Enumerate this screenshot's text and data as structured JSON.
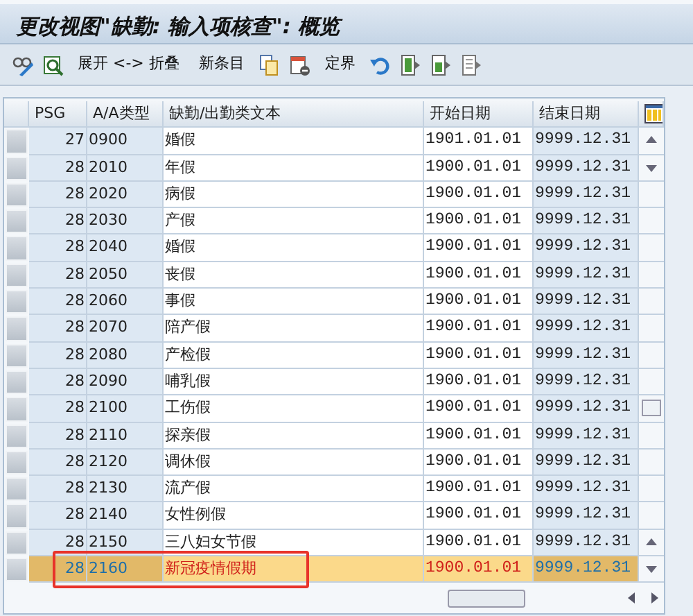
{
  "window": {
    "title": "更改视图\"缺勤: 输入项核查\": 概览"
  },
  "toolbar": [
    {
      "kind": "icon"
    },
    {
      "kind": "icon"
    },
    {
      "kind": "text",
      "label": "展开 <-> 折叠"
    },
    {
      "kind": "text",
      "label": "新条目"
    },
    {
      "kind": "icon"
    },
    {
      "kind": "icon"
    },
    {
      "kind": "text",
      "label": "定界"
    },
    {
      "kind": "icon"
    },
    {
      "kind": "icon"
    },
    {
      "kind": "icon"
    },
    {
      "kind": "icon"
    }
  ],
  "table": {
    "columns": [
      "PSG",
      "A/A类型",
      "缺勤/出勤类文本",
      "开始日期",
      "结束日期"
    ],
    "rows": [
      {
        "psg": "27",
        "type": "0900",
        "text": "婚假",
        "start": "1901.01.01",
        "end": "9999.12.31",
        "selected": false
      },
      {
        "psg": "28",
        "type": "2010",
        "text": "年假",
        "start": "1900.01.01",
        "end": "9999.12.31",
        "selected": false
      },
      {
        "psg": "28",
        "type": "2020",
        "text": "病假",
        "start": "1900.01.01",
        "end": "9999.12.31",
        "selected": false
      },
      {
        "psg": "28",
        "type": "2030",
        "text": "产假",
        "start": "1900.01.01",
        "end": "9999.12.31",
        "selected": false
      },
      {
        "psg": "28",
        "type": "2040",
        "text": "婚假",
        "start": "1900.01.01",
        "end": "9999.12.31",
        "selected": false
      },
      {
        "psg": "28",
        "type": "2050",
        "text": "丧假",
        "start": "1900.01.01",
        "end": "9999.12.31",
        "selected": false
      },
      {
        "psg": "28",
        "type": "2060",
        "text": "事假",
        "start": "1900.01.01",
        "end": "9999.12.31",
        "selected": false
      },
      {
        "psg": "28",
        "type": "2070",
        "text": "陪产假",
        "start": "1900.01.01",
        "end": "9999.12.31",
        "selected": false
      },
      {
        "psg": "28",
        "type": "2080",
        "text": "产检假",
        "start": "1900.01.01",
        "end": "9999.12.31",
        "selected": false
      },
      {
        "psg": "28",
        "type": "2090",
        "text": "哺乳假",
        "start": "1900.01.01",
        "end": "9999.12.31",
        "selected": false
      },
      {
        "psg": "28",
        "type": "2100",
        "text": "工伤假",
        "start": "1900.01.01",
        "end": "9999.12.31",
        "selected": false
      },
      {
        "psg": "28",
        "type": "2110",
        "text": "探亲假",
        "start": "1900.01.01",
        "end": "9999.12.31",
        "selected": false
      },
      {
        "psg": "28",
        "type": "2120",
        "text": "调休假",
        "start": "1900.01.01",
        "end": "9999.12.31",
        "selected": false
      },
      {
        "psg": "28",
        "type": "2130",
        "text": "流产假",
        "start": "1900.01.01",
        "end": "9999.12.31",
        "selected": false
      },
      {
        "psg": "28",
        "type": "2140",
        "text": "女性例假",
        "start": "1900.01.01",
        "end": "9999.12.31",
        "selected": false
      },
      {
        "psg": "28",
        "type": "2150",
        "text": "三八妇女节假",
        "start": "1900.01.01",
        "end": "9999.12.31",
        "selected": false
      },
      {
        "psg": "28",
        "type": "2160",
        "text": "新冠疫情假期",
        "start": "1900.01.01",
        "end": "9999.12.31",
        "selected": true
      }
    ]
  }
}
